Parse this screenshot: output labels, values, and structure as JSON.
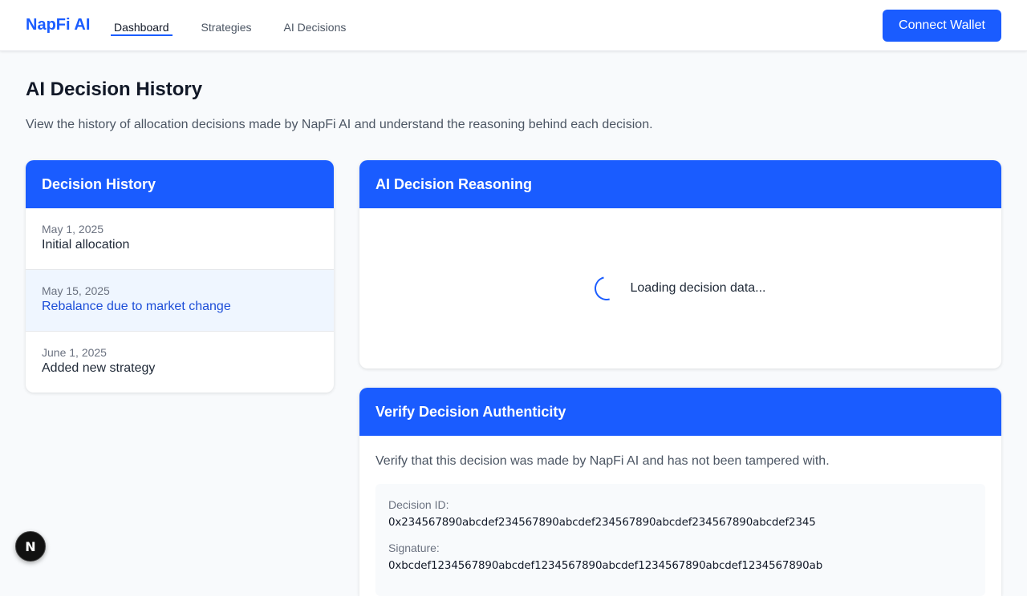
{
  "brand": "NapFi AI",
  "nav": [
    {
      "label": "Dashboard",
      "active": true
    },
    {
      "label": "Strategies",
      "active": false
    },
    {
      "label": "AI Decisions",
      "active": false
    }
  ],
  "connect_button": "Connect Wallet",
  "page": {
    "title": "AI Decision History",
    "description": "View the history of allocation decisions made by NapFi AI and understand the reasoning behind each decision."
  },
  "history": {
    "title": "Decision History",
    "items": [
      {
        "date": "May 1, 2025",
        "title": "Initial allocation",
        "selected": false
      },
      {
        "date": "May 15, 2025",
        "title": "Rebalance due to market change",
        "selected": true
      },
      {
        "date": "June 1, 2025",
        "title": "Added new strategy",
        "selected": false
      }
    ]
  },
  "reasoning": {
    "title": "AI Decision Reasoning",
    "loading_text": "Loading decision data..."
  },
  "verify": {
    "title": "Verify Decision Authenticity",
    "description": "Verify that this decision was made by NapFi AI and has not been tampered with.",
    "decision_id_label": "Decision ID:",
    "decision_id": "0x234567890abcdef234567890abcdef234567890abcdef234567890abcdef2345",
    "signature_label": "Signature:",
    "signature": "0xbcdef1234567890abcdef1234567890abcdef1234567890abcdef1234567890ab"
  },
  "dev_badge": "N",
  "colors": {
    "accent": "#1a5cff",
    "selected_bg": "#eff6ff"
  }
}
